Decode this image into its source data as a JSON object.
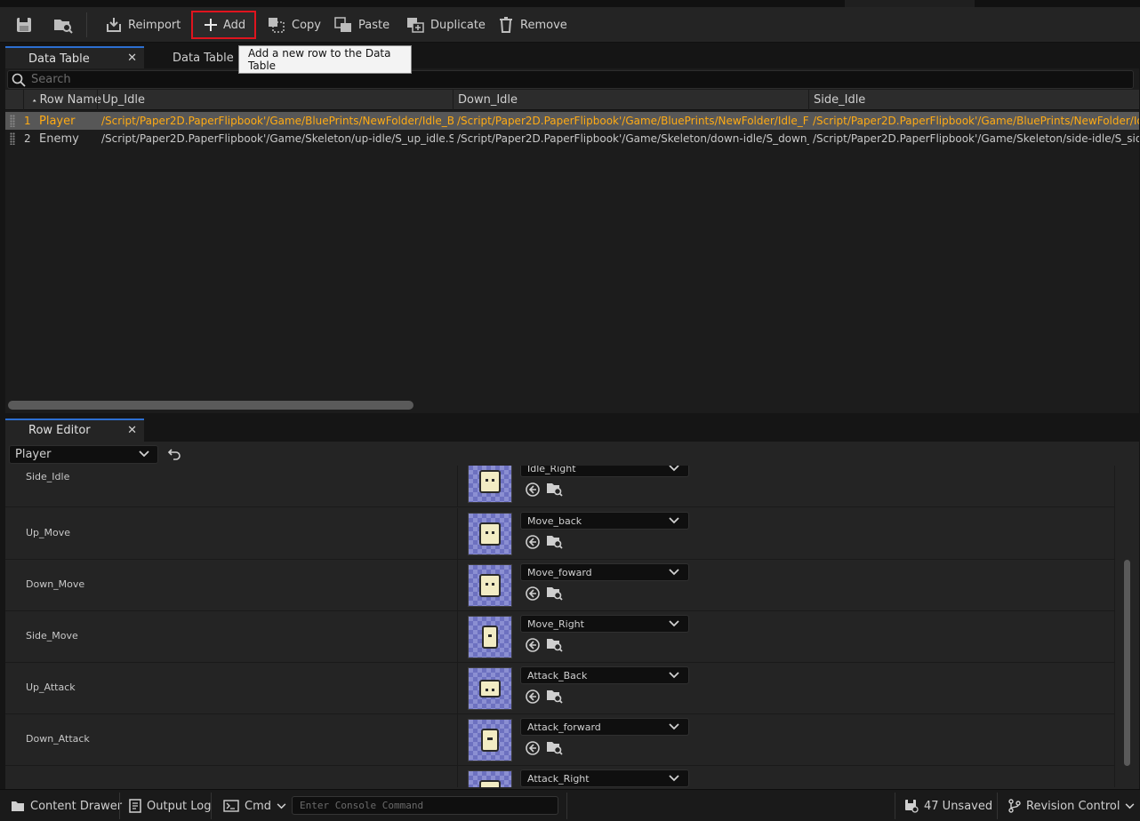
{
  "toolbar": {
    "reimport_label": "Reimport",
    "add_label": "Add",
    "copy_label": "Copy",
    "paste_label": "Paste",
    "duplicate_label": "Duplicate",
    "remove_label": "Remove"
  },
  "tabs": [
    {
      "label": "Data Table",
      "active": true
    },
    {
      "label": "Data Table D",
      "active": false
    }
  ],
  "tooltip": "Add a new row to the Data Table",
  "search": {
    "placeholder": "Search"
  },
  "table": {
    "columns": [
      "Row Name",
      "Up_Idle",
      "Down_Idle",
      "Side_Idle"
    ],
    "rows": [
      {
        "index": "1",
        "name": "Player",
        "up_idle": "/Script/Paper2D.PaperFlipbook'/Game/BluePrints/NewFolder/Idle_Back.",
        "down_idle": "/Script/Paper2D.PaperFlipbook'/Game/BluePrints/NewFolder/Idle_Forwa",
        "side_idle": "/Script/Paper2D.PaperFlipbook'/Game/BluePrints/NewFolder/Idle_",
        "selected": true
      },
      {
        "index": "2",
        "name": "Enemy",
        "up_idle": "/Script/Paper2D.PaperFlipbook'/Game/Skeleton/up-idle/S_up_idle.S_up_",
        "down_idle": "/Script/Paper2D.PaperFlipbook'/Game/Skeleton/down-idle/S_down_idle.",
        "side_idle": "/Script/Paper2D.PaperFlipbook'/Game/Skeleton/side-idle/S_side_id",
        "selected": false
      }
    ]
  },
  "row_editor": {
    "tab_label": "Row Editor",
    "selected_row": "Player",
    "properties": [
      {
        "label": "Side_Idle",
        "asset": "Idle_Right"
      },
      {
        "label": "Up_Move",
        "asset": "Move_back"
      },
      {
        "label": "Down_Move",
        "asset": "Move_foward"
      },
      {
        "label": "Side_Move",
        "asset": "Move_Right"
      },
      {
        "label": "Up_Attack",
        "asset": "Attack_Back"
      },
      {
        "label": "Down_Attack",
        "asset": "Attack_forward"
      },
      {
        "label": "",
        "asset": "Attack_Right"
      }
    ]
  },
  "status_bar": {
    "content_drawer": "Content Drawer",
    "output_log": "Output Log",
    "cmd": "Cmd",
    "console_placeholder": "Enter Console Command",
    "unsaved": "47 Unsaved",
    "revision_control": "Revision Control"
  },
  "colors": {
    "accent": "#2d6fd1",
    "selected_text": "#ffab14",
    "highlight_border": "#e0141e"
  }
}
